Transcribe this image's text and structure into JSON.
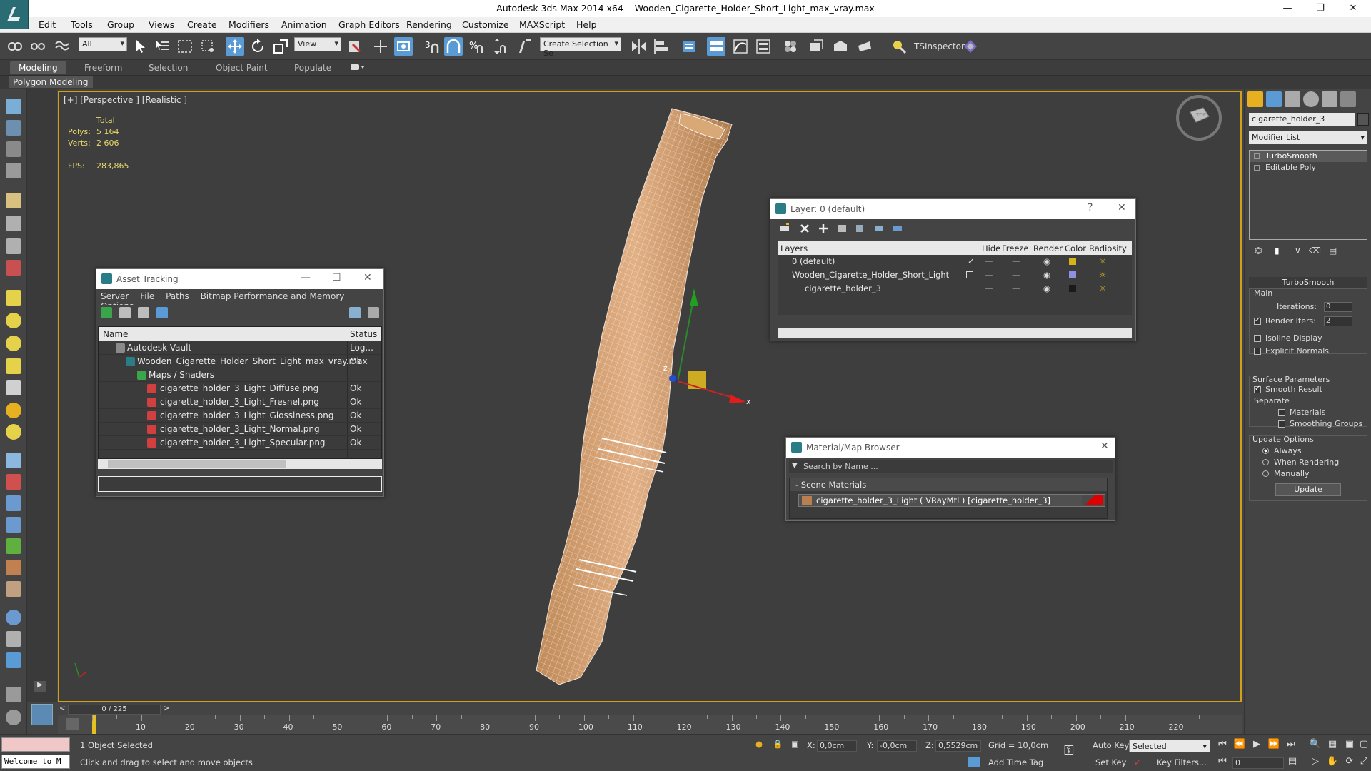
{
  "window": {
    "app_title": "Autodesk 3ds Max  2014 x64",
    "file_title": "Wooden_Cigarette_Holder_Short_Light_max_vray.max"
  },
  "menu": [
    "Edit",
    "Tools",
    "Group",
    "Views",
    "Create",
    "Modifiers",
    "Animation",
    "Graph Editors",
    "Rendering",
    "Customize",
    "MAXScript",
    "Help"
  ],
  "toolbar": {
    "filter_value": "All",
    "refcoord_value": "View",
    "selection_set_placeholder": "Create Selection Se",
    "snap_label": "3",
    "tsinspector_label": "TSInspector"
  },
  "ribbon": {
    "tabs": [
      "Modeling",
      "Freeform",
      "Selection",
      "Object Paint",
      "Populate"
    ],
    "active_tab": "Modeling",
    "sub_label": "Polygon Modeling"
  },
  "viewport": {
    "label": "[+] [Perspective ] [Realistic ]",
    "stats_header": "Total",
    "polys_label": "Polys:",
    "polys_value": "5 164",
    "verts_label": "Verts:",
    "verts_value": "2 606",
    "fps_label": "FPS:",
    "fps_value": "283,865",
    "gizmo_x": "x",
    "gizmo_z": "z",
    "viewcube_label": "TOP"
  },
  "asset_tracking": {
    "title": "Asset Tracking",
    "menu": [
      "Server",
      "File",
      "Paths",
      "Bitmap Performance and Memory",
      "Options"
    ],
    "col_name": "Name",
    "col_status": "Status",
    "rows": [
      {
        "name": "Autodesk Vault",
        "status": "Log..."
      },
      {
        "name": "Wooden_Cigarette_Holder_Short_Light_max_vray.max",
        "status": "Ok"
      },
      {
        "name": "Maps / Shaders",
        "status": ""
      },
      {
        "name": "cigarette_holder_3_Light_Diffuse.png",
        "status": "Ok"
      },
      {
        "name": "cigarette_holder_3_Light_Fresnel.png",
        "status": "Ok"
      },
      {
        "name": "cigarette_holder_3_Light_Glossiness.png",
        "status": "Ok"
      },
      {
        "name": "cigarette_holder_3_Light_Normal.png",
        "status": "Ok"
      },
      {
        "name": "cigarette_holder_3_Light_Specular.png",
        "status": "Ok"
      }
    ]
  },
  "layer_dialog": {
    "title": "Layer: 0 (default)",
    "help": "?",
    "columns": [
      "Layers",
      "Hide",
      "Freeze",
      "Render",
      "Color",
      "Radiosity"
    ],
    "rows": [
      {
        "name": "0 (default)",
        "color": "#d4b21a"
      },
      {
        "name": "Wooden_Cigarette_Holder_Short_Light",
        "color": "#9090e0"
      },
      {
        "name": "cigarette_holder_3",
        "color": "#1a1a1a"
      }
    ]
  },
  "material_browser": {
    "title": "Material/Map Browser",
    "search_placeholder": "Search by Name ...",
    "group": "- Scene Materials",
    "material": "cigarette_holder_3_Light  ( VRayMtl )  [cigarette_holder_3]"
  },
  "command_panel": {
    "object_name": "cigarette_holder_3",
    "modifier_list": "Modifier List",
    "stack": [
      "TurboSmooth",
      "Editable Poly"
    ],
    "rollout_title": "TurboSmooth",
    "main_label": "Main",
    "iterations_label": "Iterations:",
    "iterations_value": "0",
    "render_iters_label": "Render Iters:",
    "render_iters_value": "2",
    "isoline_label": "Isoline Display",
    "explicit_normals_label": "Explicit Normals",
    "surface_params_label": "Surface Parameters",
    "smooth_result_label": "Smooth Result",
    "separate_label": "Separate",
    "materials_label": "Materials",
    "smoothing_groups_label": "Smoothing Groups",
    "update_options_label": "Update Options",
    "always_label": "Always",
    "when_rendering_label": "When Rendering",
    "manually_label": "Manually",
    "update_button": "Update"
  },
  "timeline": {
    "frame_counter": "0 / 225",
    "ticks": [
      "10",
      "20",
      "30",
      "40",
      "50",
      "60",
      "70",
      "80",
      "90",
      "100",
      "110",
      "120",
      "130",
      "140",
      "150",
      "160",
      "170",
      "180",
      "190",
      "200",
      "210",
      "220"
    ]
  },
  "status": {
    "listener_text": "Welcome to M",
    "selected_count": "1 Object Selected",
    "prompt": "Click and drag to select and move objects",
    "x_label": "X:",
    "x_value": "0,0cm",
    "y_label": "Y:",
    "y_value": "-0,0cm",
    "z_label": "Z:",
    "z_value": "0,5529cm",
    "grid": "Grid = 10,0cm",
    "add_time_tag": "Add Time Tag",
    "auto_key": "Auto Key",
    "set_key": "Set Key",
    "selected_dropdown": "Selected",
    "key_filters": "Key Filters...",
    "frame_value": "0"
  }
}
